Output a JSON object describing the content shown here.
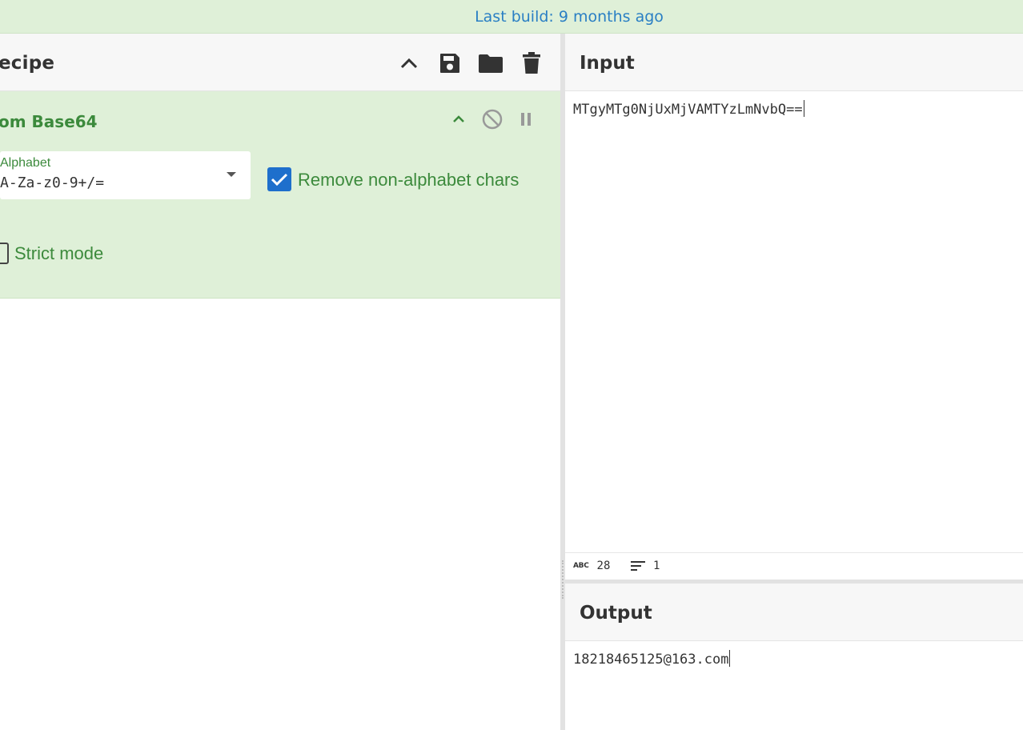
{
  "banner": {
    "text": "Last build: 9 months ago"
  },
  "recipe": {
    "title": "ecipe",
    "actions": [
      {
        "name": "collapse-all",
        "icon": "chevron-up-icon"
      },
      {
        "name": "save",
        "icon": "save-icon"
      },
      {
        "name": "load",
        "icon": "folder-icon"
      },
      {
        "name": "clear",
        "icon": "trash-icon"
      }
    ],
    "operation": {
      "title": "om Base64",
      "icons": [
        "chevron-up-icon",
        "disable-icon",
        "pause-icon"
      ],
      "alphabet_label": "Alphabet",
      "alphabet_value": "A-Za-z0-9+/=",
      "remove_non_alphabet_label": "Remove non-alphabet chars",
      "remove_non_alphabet_checked": true,
      "strict_mode_label": "Strict mode",
      "strict_mode_checked": false
    }
  },
  "input": {
    "title": "Input",
    "text": "MTgyMTg0NjUxMjVAMTYzLmNvbQ=="
  },
  "status": {
    "char_count": "28",
    "line_count": "1"
  },
  "output": {
    "title": "Output",
    "text": "18218465125@163.com"
  },
  "colors": {
    "banner_bg": "#dff0d8",
    "banner_text": "#2a7fc4",
    "operation_bg": "#dff0d8",
    "operation_text": "#3c8a3c",
    "checkbox_blue": "#1e6fcc"
  }
}
